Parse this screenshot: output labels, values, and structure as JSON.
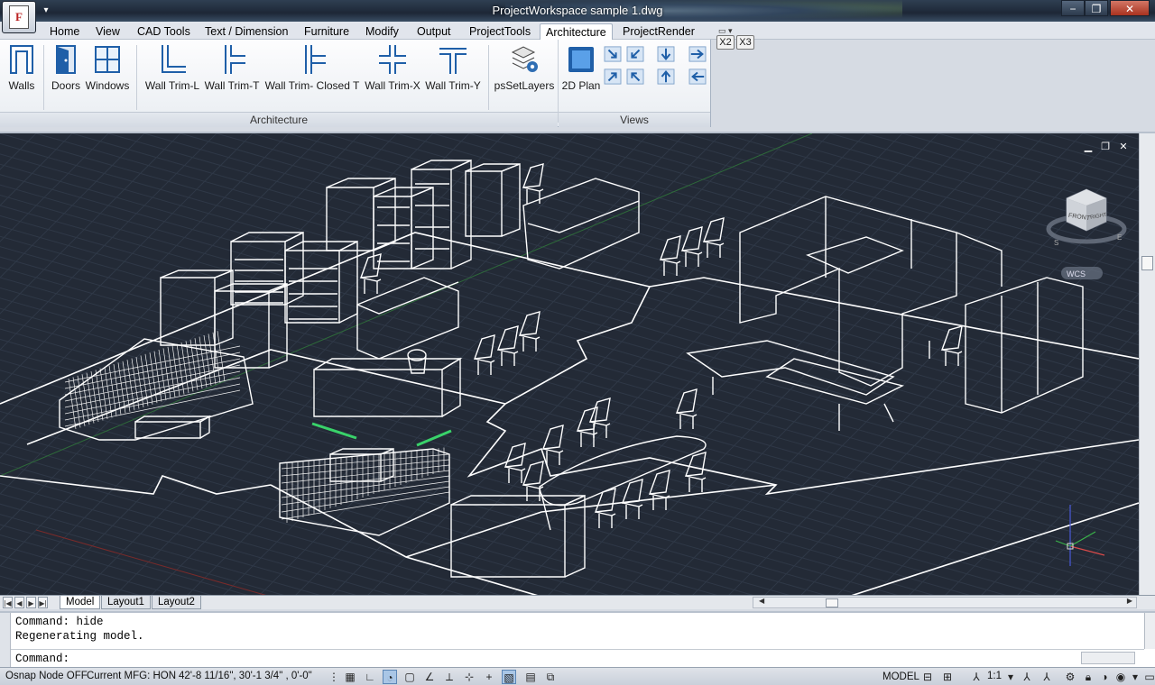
{
  "window": {
    "title": "ProjectWorkspace - [sample 1.dwg]",
    "title_display": "ProjectWorkspace   sample 1.dwg",
    "app_logo_letter": "F",
    "controls": {
      "minimize": "−",
      "restore": "❐",
      "close": "✕"
    }
  },
  "ribbon_tabs": [
    "Home",
    "View",
    "CAD Tools",
    "Text / Dimension",
    "Furniture",
    "Modify",
    "Output",
    "ProjectTools",
    "Architecture",
    "ProjectRender"
  ],
  "active_tab": "Architecture",
  "flyout_buttons": [
    "X2",
    "X3"
  ],
  "ribbon": {
    "architecture_panel": {
      "name": "Architecture",
      "tools": [
        "Walls",
        "Doors",
        "Windows",
        "Wall Trim-L",
        "Wall Trim-T",
        "Wall Trim- Closed T",
        "Wall Trim-X",
        "Wall Trim-Y",
        "psSetLayers"
      ]
    },
    "views_panel": {
      "name": "Views",
      "main_tool": "2D Plan",
      "view_buttons": [
        "view-sw-icon",
        "view-se-icon",
        "view-ne-icon",
        "view-nw-icon",
        "view-down-icon",
        "view-up-icon",
        "view-right-icon",
        "view-left-icon"
      ]
    }
  },
  "viewport": {
    "controls": {
      "minimize": "▁",
      "restore": "❐",
      "close": "✕"
    },
    "viewcube": {
      "front": "FRONT",
      "right": "RIGHT",
      "compass_s": "S",
      "compass_e": "E",
      "wcs": "WCS"
    },
    "background": "#232a36"
  },
  "layout_tabs": [
    "Model",
    "Layout1",
    "Layout2"
  ],
  "active_layout": "Model",
  "command_history": [
    "Command: hide",
    "Regenerating model."
  ],
  "command_prompt": "Command:",
  "status": {
    "osnap": "Osnap Node OFF",
    "mfg": "Current MFG: HON",
    "coordinates": "42'-8 11/16\", 30'-1 3/4\" , 0'-0\"",
    "model_label": "MODEL",
    "annotation_scale": "1:1",
    "toggles": [
      "snap",
      "grid",
      "ortho",
      "polar",
      "osnap",
      "otrack",
      "ducs",
      "dyn",
      "lineweight",
      "tpy",
      "qp",
      "sc"
    ],
    "active_toggles": [
      "polar",
      "osnap",
      "qp"
    ]
  }
}
